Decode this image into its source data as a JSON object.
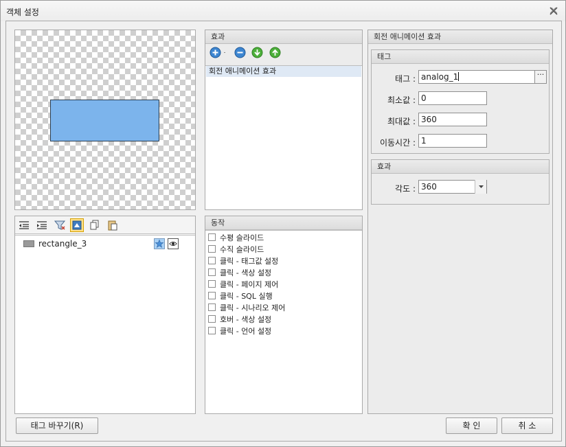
{
  "window": {
    "title": "객체 설정"
  },
  "effects_panel": {
    "header": "효과",
    "items": [
      "회전 애니메이션 효과"
    ]
  },
  "actions_panel": {
    "header": "동작",
    "items": [
      "수평 슬라이드",
      "수직 슬라이드",
      "클릭 - 태그값 설정",
      "클릭 - 색상 설정",
      "클릭 - 페이지 제어",
      "클릭 - SQL 실행",
      "클릭 - 시나리오 제어",
      "호버 - 색상 설정",
      "클릭 - 언어 설정"
    ]
  },
  "layers_panel": {
    "item_label": "rectangle_3"
  },
  "settings_panel": {
    "header": "회전 애니메이션 효과",
    "tag_section": {
      "header": "태그",
      "tag_label": "태그 :",
      "tag_value": "analog_1",
      "min_label": "최소값 :",
      "min_value": "0",
      "max_label": "최대값 :",
      "max_value": "360",
      "move_label": "이동시간 :",
      "move_value": "1",
      "browse_label": "···"
    },
    "effect_section": {
      "header": "효과",
      "angle_label": "각도 :",
      "angle_value": "360"
    }
  },
  "buttons": {
    "change_tag": "태그 바꾸기(R)",
    "ok": "확 인",
    "cancel": "취 소"
  },
  "colors": {
    "preview_fill": "#7cb4ec",
    "selection": "#dfe9f5"
  }
}
